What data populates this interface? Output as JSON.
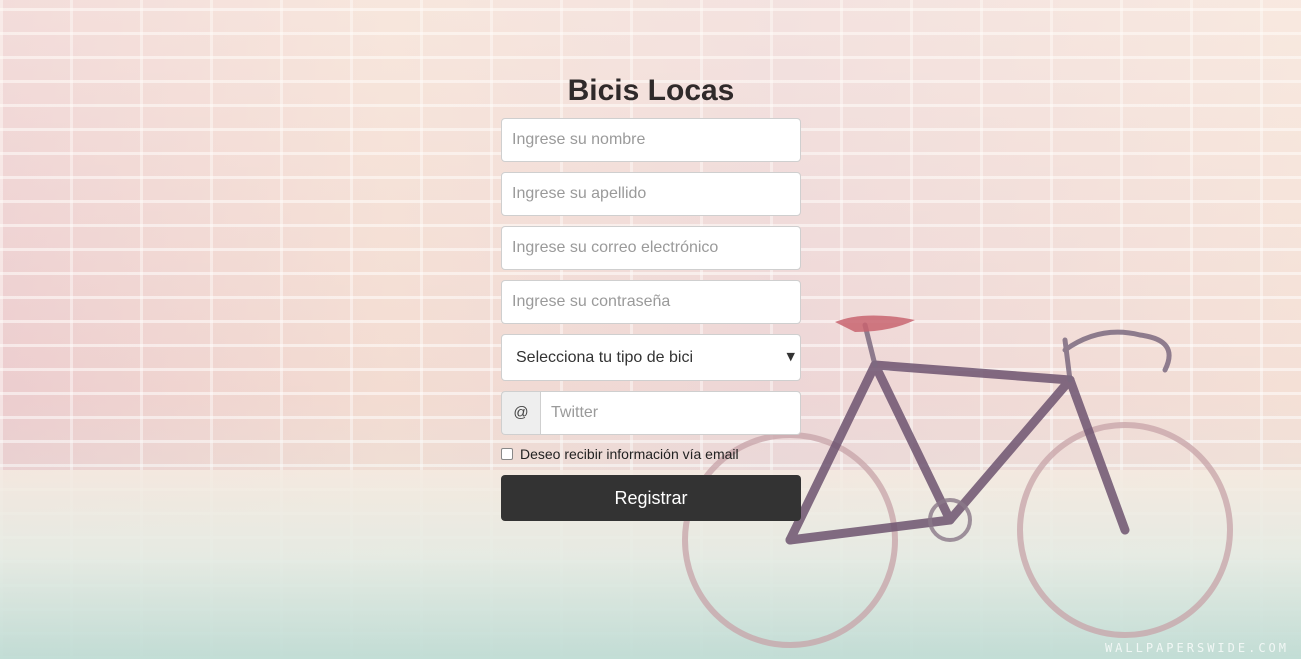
{
  "page": {
    "title": "Bicis Locas",
    "watermark": "WALLPAPERSWIDE.COM"
  },
  "form": {
    "name_placeholder": "Ingrese su nombre",
    "lastname_placeholder": "Ingrese su apellido",
    "email_placeholder": "Ingrese su correo electrónico",
    "password_placeholder": "Ingrese su contraseña",
    "bike_select": {
      "selected": "Selecciona tu tipo de bici"
    },
    "twitter": {
      "addon": "@",
      "placeholder": "Twitter"
    },
    "newsletter_label": "Deseo recibir información vía email",
    "submit_label": "Registrar"
  },
  "colors": {
    "button_bg": "#333333",
    "title_color": "#2f2a2a"
  }
}
